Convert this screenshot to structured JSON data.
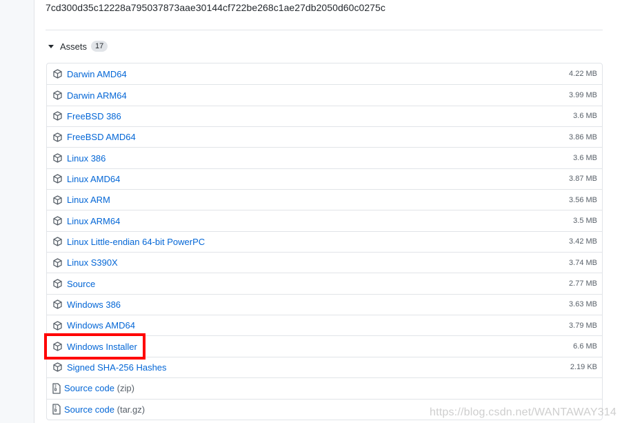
{
  "release": {
    "commit_hash": "7cd300d35c12228a795037873aae30144cf722be268c1ae27db2050d60c0275c"
  },
  "assets": {
    "title": "Assets",
    "count": "17",
    "items": [
      {
        "label": "Darwin AMD64",
        "size": "4.22 MB",
        "icon": "package-icon"
      },
      {
        "label": "Darwin ARM64",
        "size": "3.99 MB",
        "icon": "package-icon"
      },
      {
        "label": "FreeBSD 386",
        "size": "3.6 MB",
        "icon": "package-icon"
      },
      {
        "label": "FreeBSD AMD64",
        "size": "3.86 MB",
        "icon": "package-icon"
      },
      {
        "label": "Linux 386",
        "size": "3.6 MB",
        "icon": "package-icon"
      },
      {
        "label": "Linux AMD64",
        "size": "3.87 MB",
        "icon": "package-icon"
      },
      {
        "label": "Linux ARM",
        "size": "3.56 MB",
        "icon": "package-icon"
      },
      {
        "label": "Linux ARM64",
        "size": "3.5 MB",
        "icon": "package-icon"
      },
      {
        "label": "Linux Little-endian 64-bit PowerPC",
        "size": "3.42 MB",
        "icon": "package-icon"
      },
      {
        "label": "Linux S390X",
        "size": "3.74 MB",
        "icon": "package-icon"
      },
      {
        "label": "Source",
        "size": "2.77 MB",
        "icon": "package-icon"
      },
      {
        "label": "Windows 386",
        "size": "3.63 MB",
        "icon": "package-icon"
      },
      {
        "label": "Windows AMD64",
        "size": "3.79 MB",
        "icon": "package-icon"
      },
      {
        "label": "Windows Installer",
        "size": "6.6 MB",
        "icon": "package-icon"
      },
      {
        "label": "Signed SHA-256 Hashes",
        "size": "2.19 KB",
        "icon": "package-icon"
      }
    ],
    "source_archives": [
      {
        "label": "Source code",
        "suffix": "(zip)",
        "icon": "file-zip-icon"
      },
      {
        "label": "Source code",
        "suffix": "(tar.gz)",
        "icon": "file-zip-icon"
      }
    ]
  },
  "annotation": {
    "highlight_color": "#ff0000"
  },
  "watermark": "https://blog.csdn.net/WANTAWAY314",
  "colors": {
    "link": "#0366d6",
    "muted": "#586069",
    "border": "#e1e4e8"
  }
}
